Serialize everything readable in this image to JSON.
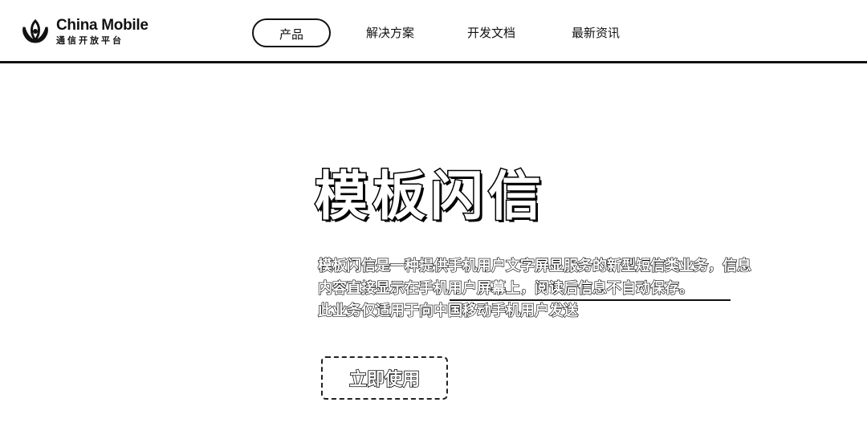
{
  "header": {
    "logo": {
      "en": "China Mobile",
      "cn": "通信开放平台"
    },
    "nav": [
      {
        "label": "产品",
        "active": true
      },
      {
        "label": "解决方案",
        "active": false
      },
      {
        "label": "开发文档",
        "active": false
      },
      {
        "label": "最新资讯",
        "active": false
      }
    ]
  },
  "hero": {
    "title": "模板闪信",
    "description_lines": [
      "模板闪信是一种提供手机用户文字屏显服务的新型短信类业务，信息",
      "内容直接显示在手机用户屏幕上，阅读后信息不自动保存。",
      "此业务仅适用于向中国移动手机用户发送"
    ],
    "cta_label": "立即使用"
  },
  "colors": {
    "text": "#111111",
    "background": "#ffffff"
  }
}
